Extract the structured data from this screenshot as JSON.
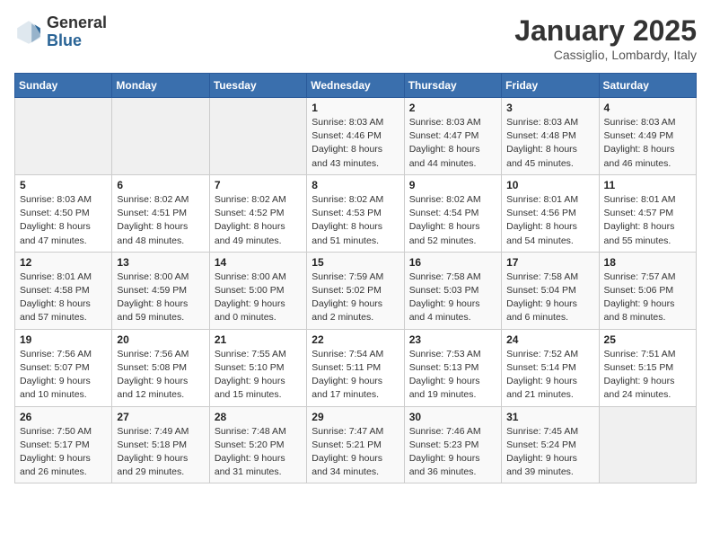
{
  "header": {
    "logo_general": "General",
    "logo_blue": "Blue",
    "month": "January 2025",
    "location": "Cassiglio, Lombardy, Italy"
  },
  "weekdays": [
    "Sunday",
    "Monday",
    "Tuesday",
    "Wednesday",
    "Thursday",
    "Friday",
    "Saturday"
  ],
  "weeks": [
    [
      {
        "day": "",
        "info": ""
      },
      {
        "day": "",
        "info": ""
      },
      {
        "day": "",
        "info": ""
      },
      {
        "day": "1",
        "info": "Sunrise: 8:03 AM\nSunset: 4:46 PM\nDaylight: 8 hours\nand 43 minutes."
      },
      {
        "day": "2",
        "info": "Sunrise: 8:03 AM\nSunset: 4:47 PM\nDaylight: 8 hours\nand 44 minutes."
      },
      {
        "day": "3",
        "info": "Sunrise: 8:03 AM\nSunset: 4:48 PM\nDaylight: 8 hours\nand 45 minutes."
      },
      {
        "day": "4",
        "info": "Sunrise: 8:03 AM\nSunset: 4:49 PM\nDaylight: 8 hours\nand 46 minutes."
      }
    ],
    [
      {
        "day": "5",
        "info": "Sunrise: 8:03 AM\nSunset: 4:50 PM\nDaylight: 8 hours\nand 47 minutes."
      },
      {
        "day": "6",
        "info": "Sunrise: 8:02 AM\nSunset: 4:51 PM\nDaylight: 8 hours\nand 48 minutes."
      },
      {
        "day": "7",
        "info": "Sunrise: 8:02 AM\nSunset: 4:52 PM\nDaylight: 8 hours\nand 49 minutes."
      },
      {
        "day": "8",
        "info": "Sunrise: 8:02 AM\nSunset: 4:53 PM\nDaylight: 8 hours\nand 51 minutes."
      },
      {
        "day": "9",
        "info": "Sunrise: 8:02 AM\nSunset: 4:54 PM\nDaylight: 8 hours\nand 52 minutes."
      },
      {
        "day": "10",
        "info": "Sunrise: 8:01 AM\nSunset: 4:56 PM\nDaylight: 8 hours\nand 54 minutes."
      },
      {
        "day": "11",
        "info": "Sunrise: 8:01 AM\nSunset: 4:57 PM\nDaylight: 8 hours\nand 55 minutes."
      }
    ],
    [
      {
        "day": "12",
        "info": "Sunrise: 8:01 AM\nSunset: 4:58 PM\nDaylight: 8 hours\nand 57 minutes."
      },
      {
        "day": "13",
        "info": "Sunrise: 8:00 AM\nSunset: 4:59 PM\nDaylight: 8 hours\nand 59 minutes."
      },
      {
        "day": "14",
        "info": "Sunrise: 8:00 AM\nSunset: 5:00 PM\nDaylight: 9 hours\nand 0 minutes."
      },
      {
        "day": "15",
        "info": "Sunrise: 7:59 AM\nSunset: 5:02 PM\nDaylight: 9 hours\nand 2 minutes."
      },
      {
        "day": "16",
        "info": "Sunrise: 7:58 AM\nSunset: 5:03 PM\nDaylight: 9 hours\nand 4 minutes."
      },
      {
        "day": "17",
        "info": "Sunrise: 7:58 AM\nSunset: 5:04 PM\nDaylight: 9 hours\nand 6 minutes."
      },
      {
        "day": "18",
        "info": "Sunrise: 7:57 AM\nSunset: 5:06 PM\nDaylight: 9 hours\nand 8 minutes."
      }
    ],
    [
      {
        "day": "19",
        "info": "Sunrise: 7:56 AM\nSunset: 5:07 PM\nDaylight: 9 hours\nand 10 minutes."
      },
      {
        "day": "20",
        "info": "Sunrise: 7:56 AM\nSunset: 5:08 PM\nDaylight: 9 hours\nand 12 minutes."
      },
      {
        "day": "21",
        "info": "Sunrise: 7:55 AM\nSunset: 5:10 PM\nDaylight: 9 hours\nand 15 minutes."
      },
      {
        "day": "22",
        "info": "Sunrise: 7:54 AM\nSunset: 5:11 PM\nDaylight: 9 hours\nand 17 minutes."
      },
      {
        "day": "23",
        "info": "Sunrise: 7:53 AM\nSunset: 5:13 PM\nDaylight: 9 hours\nand 19 minutes."
      },
      {
        "day": "24",
        "info": "Sunrise: 7:52 AM\nSunset: 5:14 PM\nDaylight: 9 hours\nand 21 minutes."
      },
      {
        "day": "25",
        "info": "Sunrise: 7:51 AM\nSunset: 5:15 PM\nDaylight: 9 hours\nand 24 minutes."
      }
    ],
    [
      {
        "day": "26",
        "info": "Sunrise: 7:50 AM\nSunset: 5:17 PM\nDaylight: 9 hours\nand 26 minutes."
      },
      {
        "day": "27",
        "info": "Sunrise: 7:49 AM\nSunset: 5:18 PM\nDaylight: 9 hours\nand 29 minutes."
      },
      {
        "day": "28",
        "info": "Sunrise: 7:48 AM\nSunset: 5:20 PM\nDaylight: 9 hours\nand 31 minutes."
      },
      {
        "day": "29",
        "info": "Sunrise: 7:47 AM\nSunset: 5:21 PM\nDaylight: 9 hours\nand 34 minutes."
      },
      {
        "day": "30",
        "info": "Sunrise: 7:46 AM\nSunset: 5:23 PM\nDaylight: 9 hours\nand 36 minutes."
      },
      {
        "day": "31",
        "info": "Sunrise: 7:45 AM\nSunset: 5:24 PM\nDaylight: 9 hours\nand 39 minutes."
      },
      {
        "day": "",
        "info": ""
      }
    ]
  ]
}
